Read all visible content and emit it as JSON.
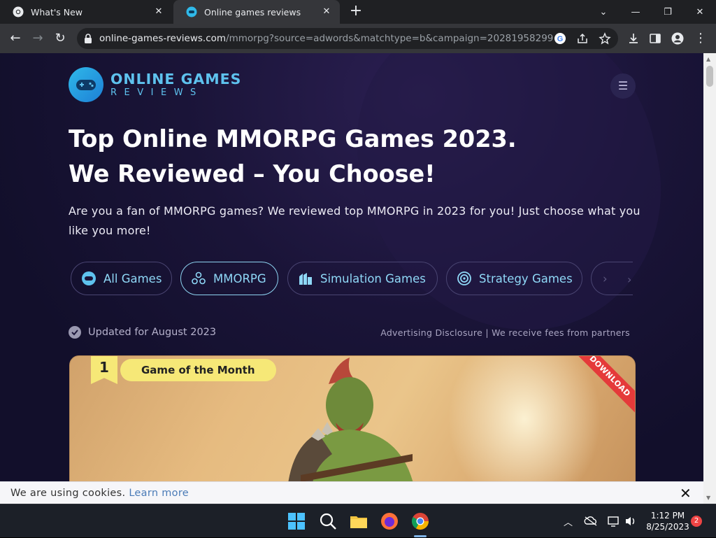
{
  "browser": {
    "tabs": [
      {
        "title": "What's New"
      },
      {
        "title": "Online games reviews"
      }
    ],
    "url_host": "online-games-reviews.com",
    "url_path": "/mmorpg?source=adwords&matchtype=b&campaign=20281958299&key..."
  },
  "site": {
    "logo_line1": "ONLINE GAMES",
    "logo_line2": "REVIEWS",
    "title_line1": "Top Online MMORPG Games 2023.",
    "title_line2": "We Reviewed – You Choose!",
    "intro": "Are you a fan of MMORPG games?  We reviewed top MMORPG in 2023 for you! Just choose what you like you more!",
    "categories": [
      {
        "label": "All Games",
        "active": false
      },
      {
        "label": "MMORPG",
        "active": true
      },
      {
        "label": "Simulation Games",
        "active": false
      },
      {
        "label": "Strategy Games",
        "active": false
      }
    ],
    "updated": "Updated for August 2023",
    "disclosure": "Advertising Disclosure | We receive fees from partners",
    "card": {
      "rank": "1",
      "badge": "Game of the Month",
      "ribbon": "DOWNLOAD"
    }
  },
  "cookie": {
    "text": "We are using cookies.",
    "link": "Learn more"
  },
  "taskbar": {
    "time": "1:12 PM",
    "date": "8/25/2023",
    "notifications": "2"
  },
  "colors": {
    "accent": "#8fd8f7",
    "page_bg": "#1a1438",
    "badge": "#f6e877",
    "ribbon": "#e53a3a"
  }
}
